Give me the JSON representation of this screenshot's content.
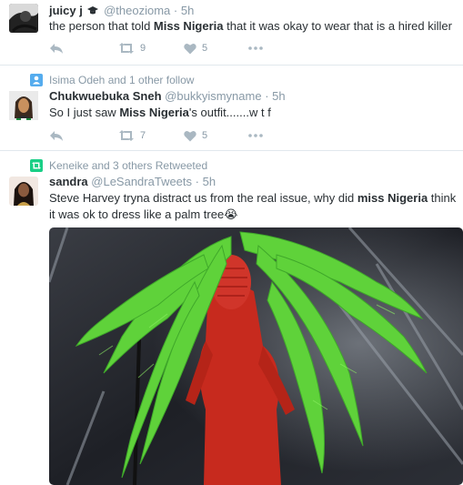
{
  "tweets": [
    {
      "name": "juicy j",
      "handle": "@theozioma",
      "time": "· 5h",
      "text_parts": [
        "the person that told ",
        "Miss Nigeria",
        " that it was okay to wear that is a hired killer"
      ],
      "retweets": "9",
      "likes": "5"
    },
    {
      "context": "Isima Odeh and 1 other follow",
      "name": "Chukwuebuka Sneh",
      "handle": "@bukkyismyname",
      "time": "· 5h",
      "text_parts": [
        "So I just saw ",
        "Miss Nigeria",
        "'s outfit.......w t f"
      ],
      "retweets": "7",
      "likes": "5"
    },
    {
      "context": "Keneike and 3 others Retweeted",
      "name": "sandra",
      "handle": "@LeSandraTweets",
      "time": "· 5h",
      "text_parts": [
        "Steve Harvey tryna distract us from the real issue, why did ",
        "miss Nigeria",
        " think it was ok to dress like a palm tree",
        "😭"
      ]
    }
  ],
  "colors": {
    "text": "#292f33",
    "muted": "#8899a6",
    "icon": "#aab8c2",
    "follow_context": "#55acee",
    "retweet_context": "#19cf86",
    "divider": "#e1e8ed"
  },
  "icons": {
    "reply": "reply-icon",
    "retweet": "retweet-icon",
    "like": "heart-icon",
    "more": "more-icon",
    "verified": "graduation-cap-icon"
  }
}
